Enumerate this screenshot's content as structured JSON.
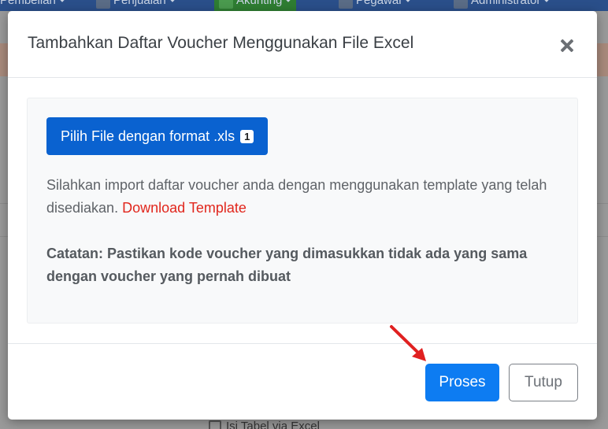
{
  "background": {
    "nav_items": [
      {
        "label": "Pembelian"
      },
      {
        "label": "Penjualan"
      },
      {
        "label": "Akunting"
      },
      {
        "label": "Pegawai"
      },
      {
        "label": "Administrator"
      }
    ],
    "bottom_text": "Isi Tabel via Excel"
  },
  "modal": {
    "title": "Tambahkan Daftar Voucher Menggunakan File Excel",
    "file_button_label": "Pilih File dengan format .xls",
    "file_count": "1",
    "description": "Silahkan import daftar voucher anda dengan menggunakan template yang telah disediakan.",
    "download_link": "Download Template",
    "note": "Catatan: Pastikan kode voucher yang dimasukkan tidak ada yang sama dengan voucher yang pernah dibuat",
    "process_button": "Proses",
    "close_button": "Tutup"
  },
  "colors": {
    "primary": "#0d7cf2",
    "file_button": "#0a62d0",
    "link": "#e1261c",
    "annotation_arrow": "#e02020"
  }
}
